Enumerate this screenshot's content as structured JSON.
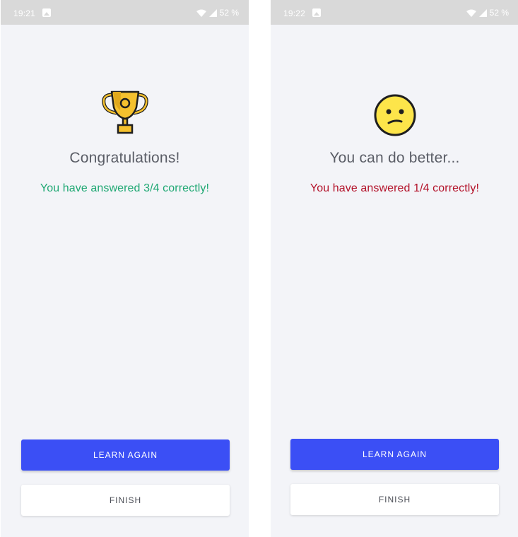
{
  "screens": [
    {
      "status_bar": {
        "time": "19:21",
        "battery": "52 %"
      },
      "result": {
        "icon": "trophy-icon",
        "headline": "Congratulations!",
        "score_text": "You have answered 3/4 correctly!",
        "score_color": "#1fa873"
      },
      "buttons": {
        "primary_label": "LEARN AGAIN",
        "secondary_label": "FINISH"
      }
    },
    {
      "status_bar": {
        "time": "19:22",
        "battery": "52 %"
      },
      "result": {
        "icon": "confused-face-icon",
        "headline": "You can do better...",
        "score_text": "You have answered 1/4 correctly!",
        "score_color": "#b3122a"
      },
      "buttons": {
        "primary_label": "LEARN AGAIN",
        "secondary_label": "FINISH"
      }
    }
  ],
  "colors": {
    "background": "#f3f4f8",
    "status_bar": "#d9d9d9",
    "primary_button": "#3b4ff5",
    "headline_text": "#5a5d66"
  }
}
